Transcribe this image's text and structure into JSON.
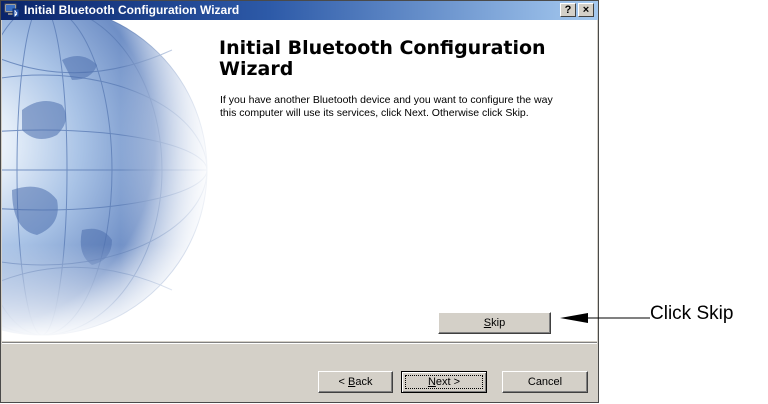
{
  "window": {
    "title": "Initial Bluetooth Configuration Wizard",
    "help_button": "?",
    "close_button": "×"
  },
  "wizard": {
    "heading": "Initial Bluetooth Configuration Wizard",
    "description": "If you have another Bluetooth device and you want to configure the way this computer will use its services, click Next. Otherwise click Skip."
  },
  "buttons": {
    "skip": {
      "accel": "S",
      "rest": "kip"
    },
    "back": {
      "prefix": "< ",
      "accel": "B",
      "rest": "ack"
    },
    "next": {
      "accel": "N",
      "rest": "ext >"
    },
    "cancel": "Cancel"
  },
  "annotation": {
    "text": "Click Skip"
  },
  "colors": {
    "titlebar_start": "#0a246a",
    "titlebar_end": "#a6caf0",
    "dialog_face": "#d4d0c8"
  }
}
